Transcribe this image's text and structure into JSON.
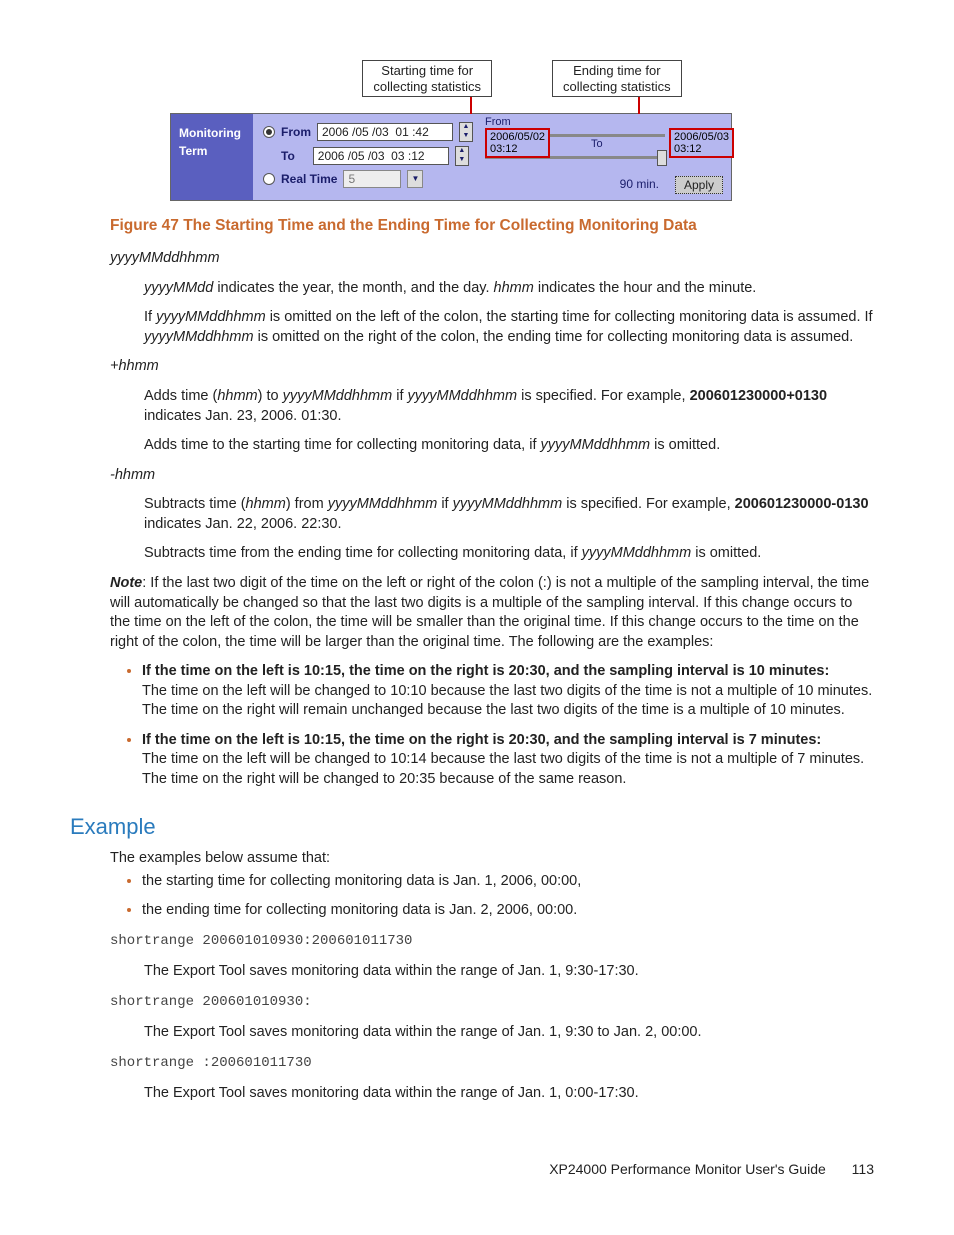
{
  "figure": {
    "callout_start": "Starting time for\ncollecting statistics",
    "callout_end": "Ending time for\ncollecting statistics",
    "panel_title_l1": "Monitoring",
    "panel_title_l2": "Term",
    "row_from": "From",
    "row_to": "To",
    "row_realtime": "Real Time",
    "from_value": "2006 /05 /03  01 :42",
    "to_value": "2006 /05 /03  03 :12",
    "rt_value": "5",
    "mini_from": "From",
    "mini_to": "To",
    "date_from": "2006/05/02\n03:12",
    "date_to": "2006/05/03\n03:12",
    "duration": "90 min.",
    "apply": "Apply"
  },
  "caption": "Figure 47 The Starting Time and the Ending Time for Collecting Monitoring Data",
  "s1_term": "yyyyMMddhhmm",
  "s1_p1a": "yyyyMMdd",
  "s1_p1b": " indicates the year, the month, and the day. ",
  "s1_p1c": "hhmm",
  "s1_p1d": " indicates the hour and the minute.",
  "s1_p2a": "If ",
  "s1_p2b": "yyyyMMddhhmm",
  "s1_p2c": " is omitted on the left of the colon, the starting time for collecting monitoring data is assumed. If ",
  "s1_p2d": "yyyyMMddhhmm",
  "s1_p2e": " is omitted on the right of the colon, the ending time for collecting monitoring data is assumed.",
  "s2_term": "+hhmm",
  "s2_p1a": "Adds time (",
  "s2_p1b": "hhmm",
  "s2_p1c": ") to ",
  "s2_p1d": "yyyyMMddhhmm",
  "s2_p1e": " if ",
  "s2_p1f": "yyyyMMddhhmm",
  "s2_p1g": " is specified. For example, ",
  "s2_p1h": "200601230000+0130",
  "s2_p1i": " indicates Jan. 23, 2006. 01:30.",
  "s2_p2a": "Adds time to the starting time for collecting monitoring data, if ",
  "s2_p2b": "yyyyMMddhhmm",
  "s2_p2c": " is omitted.",
  "s3_term": "-hhmm",
  "s3_p1a": "Subtracts time (",
  "s3_p1b": "hhmm",
  "s3_p1c": ") from ",
  "s3_p1d": "yyyyMMddhhmm",
  "s3_p1e": " if ",
  "s3_p1f": "yyyyMMddhhmm",
  "s3_p1g": " is specified. For example, ",
  "s3_p1h": "200601230000-0130",
  "s3_p1i": " indicates Jan. 22, 2006. 22:30.",
  "s3_p2a": "Subtracts time from the ending time for collecting monitoring data, if ",
  "s3_p2b": "yyyyMMddhhmm",
  "s3_p2c": " is omitted.",
  "note_head": "Note",
  "note_body": ": If the last two digit of the time on the left or right of the colon (:) is not a multiple of the sampling interval, the time will automatically be changed so that the last two digits is a multiple of the sampling interval. If this change occurs to the time on the left of the colon, the time will be smaller than the original time. If this change occurs to the time on the right of the colon, the time will be larger than the original time. The following are the examples:",
  "b1_head": "If the time on the left is 10:15, the time on the right is 20:30, and the sampling interval is 10 minutes:",
  "b1_body": "The time on the left will be changed to 10:10 because the last two digits of the time is not a multiple of 10 minutes. The time on the right will remain unchanged because the last two digits of the time is a multiple of 10 minutes.",
  "b2_head": "If the time on the left is 10:15, the time on the right is 20:30, and the sampling interval is 7 minutes:",
  "b2_body": "The time on the left will be changed to 10:14 because the last two digits of the time is not a multiple of 7 minutes. The time on the right will be changed to 20:35 because of the same reason.",
  "example_h": "Example",
  "ex_intro": "The examples below assume that:",
  "ex_li1": "the starting time for collecting monitoring data is Jan. 1, 2006, 00:00,",
  "ex_li2": "the ending time for collecting monitoring data is Jan. 2, 2006, 00:00.",
  "cmd1": "shortrange 200601010930:200601011730",
  "res1": "The Export Tool saves monitoring data within the range of Jan. 1, 9:30-17:30.",
  "cmd2": "shortrange 200601010930:",
  "res2": "The Export Tool saves monitoring data within the range of Jan. 1, 9:30 to Jan. 2, 00:00.",
  "cmd3": "shortrange :200601011730",
  "res3": "The Export Tool saves monitoring data within the range of Jan. 1, 0:00-17:30.",
  "footer_text": "XP24000 Performance Monitor User's Guide",
  "page_num": "113"
}
